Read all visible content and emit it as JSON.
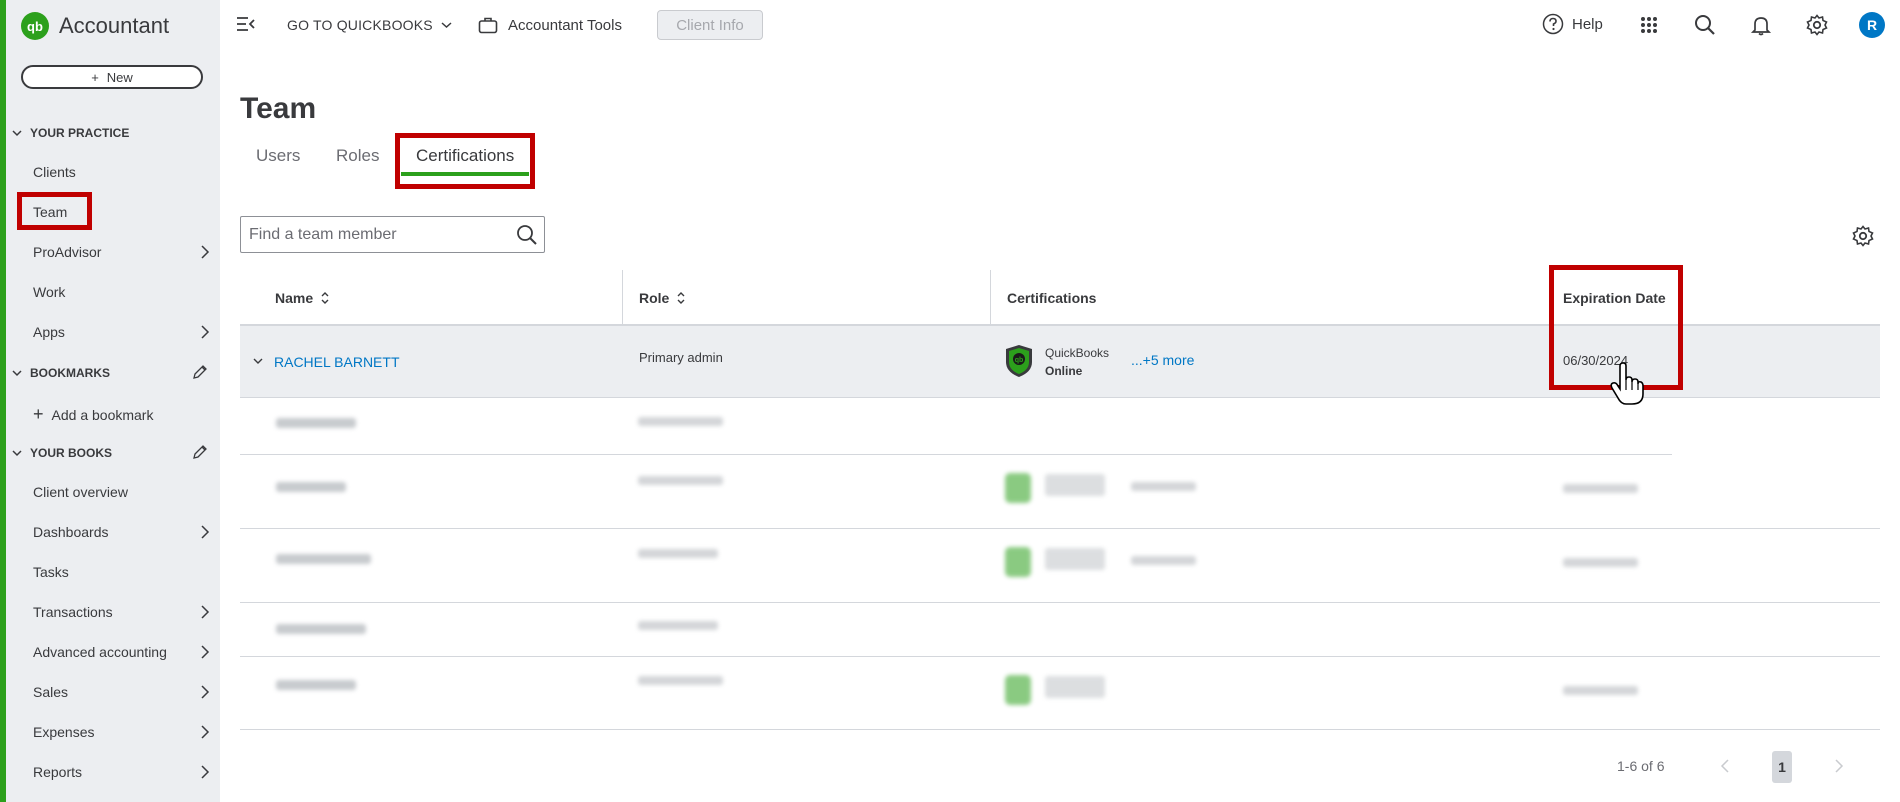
{
  "brand": {
    "name": "Accountant",
    "logo_letters": "qb"
  },
  "sidebar": {
    "new_label": "New",
    "sections": {
      "practice": "YOUR PRACTICE",
      "bookmarks": "BOOKMARKS",
      "books": "YOUR BOOKS"
    },
    "practice_items": [
      "Clients",
      "Team",
      "ProAdvisor",
      "Work",
      "Apps"
    ],
    "add_bookmark": "Add a bookmark",
    "books_items": [
      "Client overview",
      "Dashboards",
      "Tasks",
      "Transactions",
      "Advanced accounting",
      "Sales",
      "Expenses",
      "Reports"
    ]
  },
  "topbar": {
    "goto": "GO TO QUICKBOOKS",
    "accountant_tools": "Accountant Tools",
    "client_info": "Client Info",
    "help": "Help",
    "avatar_initial": "R"
  },
  "page": {
    "title": "Team",
    "tabs": [
      "Users",
      "Roles",
      "Certifications"
    ],
    "active_tab": "Certifications",
    "search_placeholder": "Find a team member"
  },
  "table": {
    "headers": {
      "name": "Name",
      "role": "Role",
      "certifications": "Certifications",
      "expiration": "Expiration Date"
    },
    "rows": [
      {
        "name": "RACHEL BARNETT",
        "role": "Primary admin",
        "cert_line1": "QuickBooks",
        "cert_line2": "Online",
        "more": "...+5 more",
        "expiration": "06/30/2024"
      }
    ]
  },
  "pagination": {
    "summary": "1-6 of 6",
    "current_page": "1"
  },
  "colors": {
    "brand_green": "#2ca01c",
    "link_blue": "#0077c5",
    "highlight_red": "#c00000",
    "sidebar_bg": "#eceef1"
  }
}
